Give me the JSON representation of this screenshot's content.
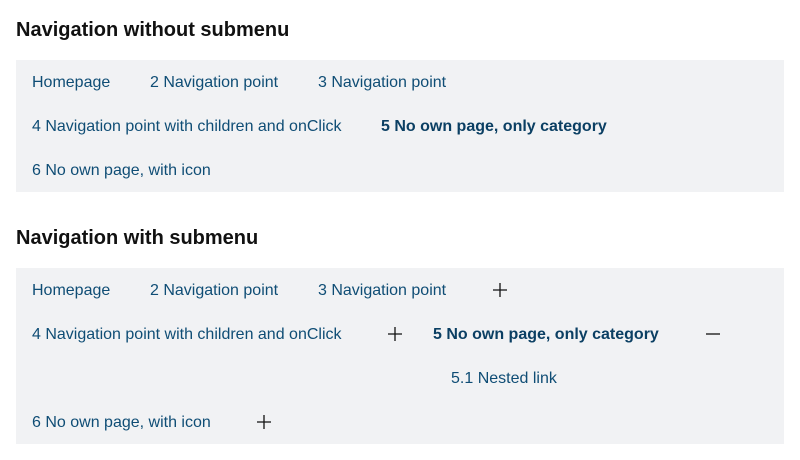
{
  "sections": [
    {
      "title": "Navigation without submenu",
      "items": [
        {
          "label": "Homepage"
        },
        {
          "label": "2 Navigation point"
        },
        {
          "label": "3 Navigation point"
        },
        {
          "label": "4 Navigation point with children and onClick"
        },
        {
          "label": "5 No own page, only category",
          "active": true
        },
        {
          "label": "6 No own page, with icon"
        }
      ]
    },
    {
      "title": "Navigation with submenu",
      "items": [
        {
          "label": "Homepage"
        },
        {
          "label": "2 Navigation point"
        },
        {
          "label": "3 Navigation point",
          "toggle": "expand"
        },
        {
          "label": "4 Navigation point with children and onClick",
          "toggle": "expand"
        },
        {
          "label": "5 No own page, only category",
          "active": true,
          "toggle": "collapse"
        },
        {
          "label": "5.1 Nested link"
        },
        {
          "label": "6 No own page, with icon",
          "toggle": "expand"
        }
      ]
    }
  ],
  "icons": {
    "expand": "plus-icon",
    "collapse": "minus-icon"
  },
  "colors": {
    "link": "#0f4d75",
    "active_link": "#0b3f63",
    "nav_background": "#f1f2f4",
    "title": "#111111"
  }
}
